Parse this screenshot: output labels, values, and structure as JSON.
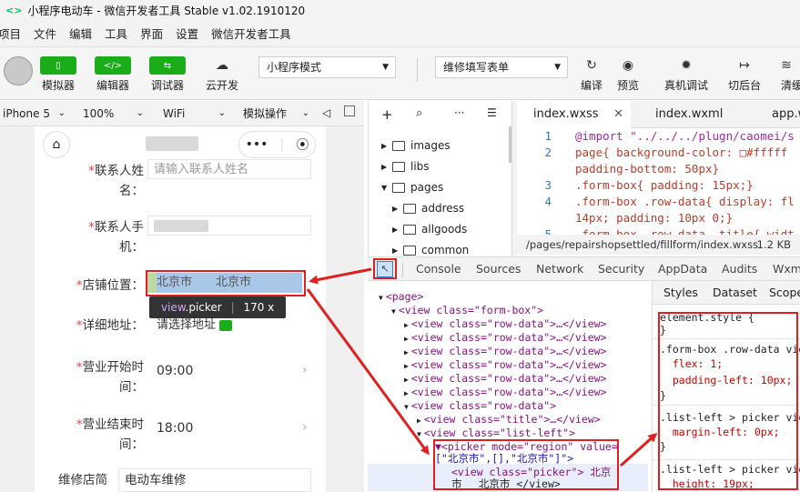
{
  "window": {
    "title": "小程序电动车 - 微信开发者工具 Stable v1.02.1910120",
    "logo": "<>"
  },
  "menu": [
    "项目",
    "文件",
    "编辑",
    "工具",
    "界面",
    "设置",
    "微信开发者工具"
  ],
  "toolbar": {
    "simulator": "模拟器",
    "editor": "编辑器",
    "debugger": "调试器",
    "cloud": "云开发",
    "mode": "小程序模式",
    "compile_target": "维修填写表单",
    "compile": "编译",
    "preview": "预览",
    "remote_debug": "真机调试",
    "background": "切后台",
    "clear_cache": "清缓"
  },
  "device_bar": {
    "device": "iPhone 5",
    "zoom": "100%",
    "network": "WiFi",
    "ops": "模拟操作"
  },
  "phone": {
    "fields": [
      {
        "label": "联系人姓名：",
        "placeholder": "请输入联系人姓名"
      },
      {
        "label": "联系人手机：",
        "placeholder": ""
      },
      {
        "label": "店铺位置：",
        "value": "北京市　　北京市"
      },
      {
        "label": "详细地址：",
        "value": "请选择地址"
      },
      {
        "label": "营业开始时间：",
        "value": "09:00"
      },
      {
        "label": "营业结束时间：",
        "value": "18:00"
      }
    ],
    "shop_label": "维修店简",
    "shop_value": "电动车维修",
    "tooltip": {
      "tag": "view",
      "cls": ".picker",
      "size": "170 x 19"
    }
  },
  "filetree": [
    "images",
    "libs",
    "pages",
    "address",
    "allgoods",
    "common"
  ],
  "editor": {
    "tabs": [
      "index.wxss",
      "index.wxml",
      "app.w"
    ],
    "lines": [
      {
        "n": "1",
        "t": "@import \"../../../plugn/caomei/s"
      },
      {
        "n": "2",
        "t": "page{ background-color: □#fffff"
      },
      {
        "n": "",
        "t": "padding-bottom: 50px}"
      },
      {
        "n": "3",
        "t": ".form-box{ padding: 15px;}"
      },
      {
        "n": "4",
        "t": ".form-box .row-data{ display: fl"
      },
      {
        "n": "",
        "t": "14px; padding: 10px 0;}"
      },
      {
        "n": "5",
        "t": ".form-box .row-data .title{ widt"
      }
    ],
    "path": "/pages/repairshopsettled/fillform/index.wxss",
    "size": "1.2 KB"
  },
  "devtools": {
    "tabs": [
      "Console",
      "Sources",
      "Network",
      "Security",
      "AppData",
      "Audits",
      "Wxm"
    ],
    "dom": [
      {
        "indent": 0,
        "arrow": "▼",
        "html": "<page>"
      },
      {
        "indent": 1,
        "arrow": "▼",
        "html": "<view class=\"form-box\">"
      },
      {
        "indent": 2,
        "arrow": "▶",
        "html": "<view class=\"row-data\">…</view>"
      },
      {
        "indent": 2,
        "arrow": "▶",
        "html": "<view class=\"row-data\">…</view>"
      },
      {
        "indent": 2,
        "arrow": "▶",
        "html": "<view class=\"row-data\">…</view>"
      },
      {
        "indent": 2,
        "arrow": "▶",
        "html": "<view class=\"row-data\">…</view>"
      },
      {
        "indent": 2,
        "arrow": "▶",
        "html": "<view class=\"row-data\">…</view>"
      },
      {
        "indent": 2,
        "arrow": "▶",
        "html": "<view class=\"row-data\">…</view>"
      },
      {
        "indent": 2,
        "arrow": "▼",
        "html": "<view class=\"row-data\">"
      },
      {
        "indent": 3,
        "arrow": "▶",
        "html": "<view class=\"title\">…</view>"
      },
      {
        "indent": 3,
        "arrow": "▼",
        "html": "<view class=\"list-left\">"
      }
    ],
    "picker_lines": [
      "▼<picker mode=\"region\" value=",
      "[\"北京市\",[],\"北京市\"]\">",
      "<view class=\"picker\"> 北京",
      "市　 北京市 </view>"
    ],
    "style_tabs": [
      "Styles",
      "Dataset",
      "Scope"
    ],
    "styles": [
      [
        "element.style {",
        "}"
      ],
      [
        ".form-box .row-data vie",
        "  flex: 1;",
        "  padding-left: 10px;",
        "}"
      ],
      [
        ".list-left > picker vie",
        "  margin-left: 0px;",
        "}"
      ],
      [
        ".list-left > picker vie",
        "  height: 19px;"
      ]
    ]
  }
}
